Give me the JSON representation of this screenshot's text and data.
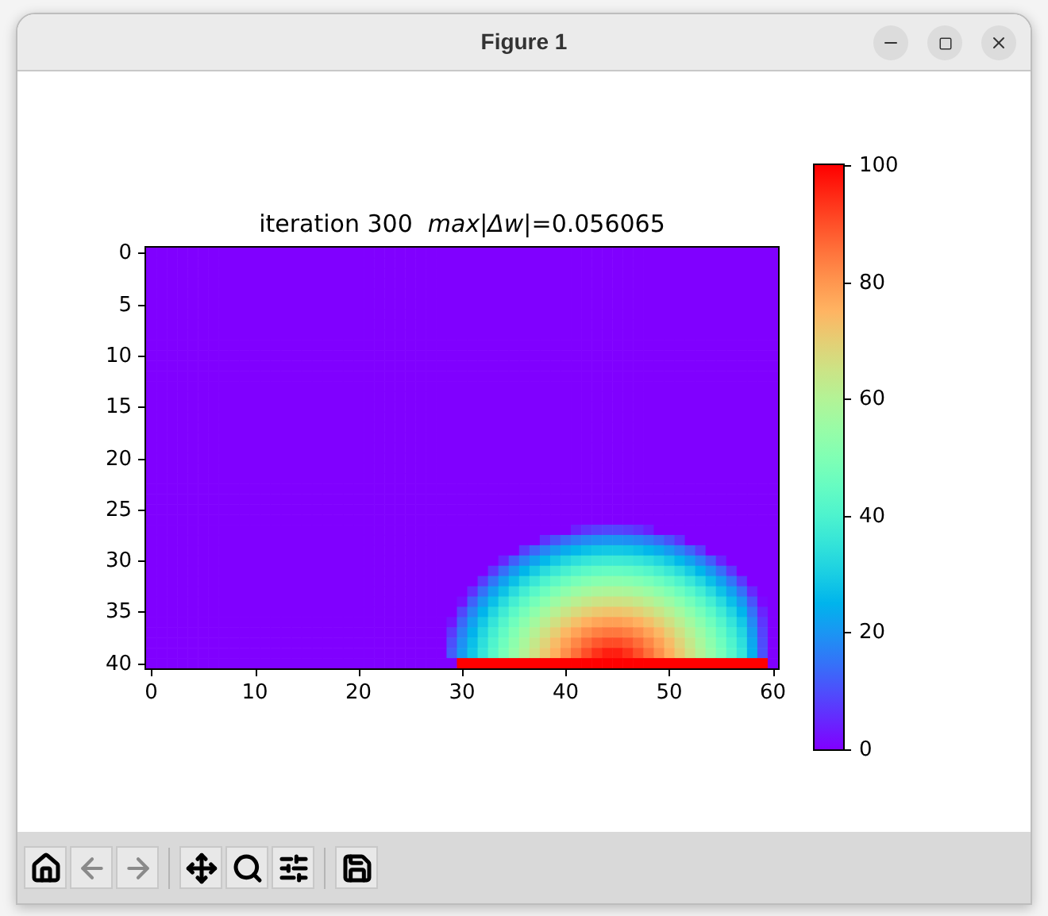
{
  "window": {
    "title": "Figure 1",
    "controls": [
      {
        "kind": "minimize"
      },
      {
        "kind": "maximize"
      },
      {
        "kind": "close"
      }
    ]
  },
  "plot": {
    "title": "iteration 300  *max|Δw|*=0.056065",
    "xticks": [
      "0",
      "10",
      "20",
      "30",
      "40",
      "50",
      "60"
    ],
    "yticks": [
      "0",
      "5",
      "10",
      "15",
      "20",
      "25",
      "30",
      "35",
      "40"
    ],
    "colorbar_ticks": [
      "100",
      "80",
      "60",
      "40",
      "20",
      "0"
    ]
  },
  "toolbar": {
    "groups": [
      [
        {
          "kind": "home",
          "disabled": false
        },
        {
          "kind": "back",
          "disabled": true
        },
        {
          "kind": "forward",
          "disabled": true
        }
      ],
      [
        {
          "kind": "pan",
          "disabled": false
        },
        {
          "kind": "zoom",
          "disabled": false
        },
        {
          "kind": "configure",
          "disabled": false
        }
      ],
      [
        {
          "kind": "save",
          "disabled": false
        }
      ]
    ]
  }
}
